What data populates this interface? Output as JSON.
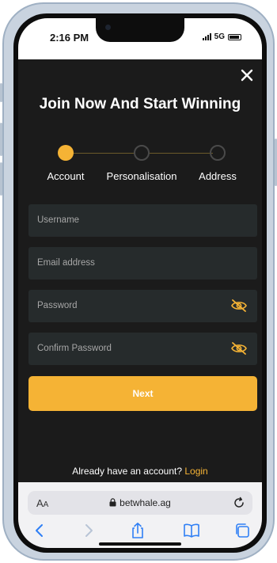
{
  "status_bar": {
    "time": "2:16 PM",
    "network": "5G"
  },
  "modal": {
    "title": "Join Now And Start Winning",
    "steps": [
      {
        "label": "Account",
        "state": "active"
      },
      {
        "label": "Personalisation",
        "state": "inactive"
      },
      {
        "label": "Address",
        "state": "inactive"
      }
    ],
    "fields": {
      "username": {
        "placeholder": "Username",
        "value": ""
      },
      "email": {
        "placeholder": "Email address",
        "value": ""
      },
      "password": {
        "placeholder": "Password",
        "value": ""
      },
      "confirm_password": {
        "placeholder": "Confirm Password",
        "value": ""
      }
    },
    "next_label": "Next",
    "login_prompt": "Already have an account?",
    "login_link": "Login"
  },
  "browser": {
    "aa_big": "A",
    "aa_small": "A",
    "url": "betwhale.ag",
    "icons": [
      "back-icon",
      "forward-icon",
      "share-icon",
      "bookmarks-icon",
      "tabs-icon",
      "reload-icon",
      "lock-icon"
    ]
  },
  "colors": {
    "accent": "#f5b335",
    "background": "#1b1b1b",
    "field": "#262b2c",
    "step_line": "#6b5a2a",
    "browser_blue": "#2f7ff5"
  }
}
